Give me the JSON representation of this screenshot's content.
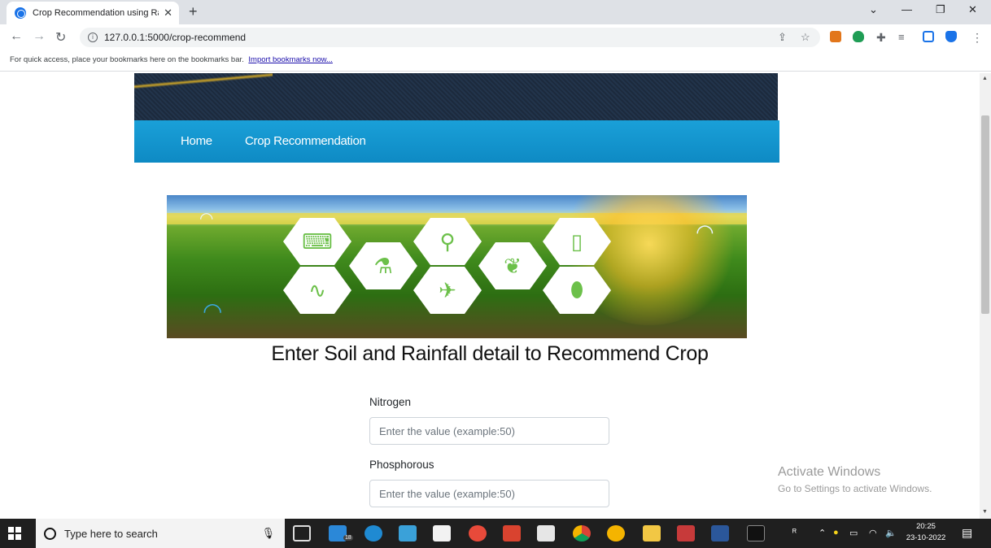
{
  "browser": {
    "tab_title": "Crop Recommendation using Ra",
    "tab_close": "✕",
    "new_tab": "+",
    "url": "127.0.0.1:5000/crop-recommend",
    "bookmarks_prompt": "For quick access, place your bookmarks here on the bookmarks bar.",
    "import_link": "Import bookmarks now..."
  },
  "nav": {
    "home": "Home",
    "crop_recommendation": "Crop Recommendation"
  },
  "page": {
    "heading": "Enter Soil and Rainfall detail to Recommend Crop"
  },
  "form": {
    "fields": [
      {
        "label": "Nitrogen",
        "placeholder": "Enter the value (example:50)"
      },
      {
        "label": "Phosphorous",
        "placeholder": "Enter the value (example:50)"
      }
    ]
  },
  "watermark": {
    "title": "Activate Windows",
    "subtitle": "Go to Settings to activate Windows."
  },
  "taskbar": {
    "search_placeholder": "Type here to search",
    "mail_badge": "18",
    "time": "20:25",
    "date": "23-10-2022"
  },
  "colors": {
    "nav_blue": "#1aa0d8",
    "header_dark": "#1c2a3d",
    "hex_icon_green": "#6cc04a"
  },
  "icons": [
    "back-icon",
    "forward-icon",
    "reload-icon",
    "info-icon",
    "share-icon",
    "star-icon",
    "metamask-icon",
    "shield-icon",
    "puzzle-icon",
    "reading-list-icon",
    "sidebar-icon",
    "browser-menu-icon"
  ]
}
